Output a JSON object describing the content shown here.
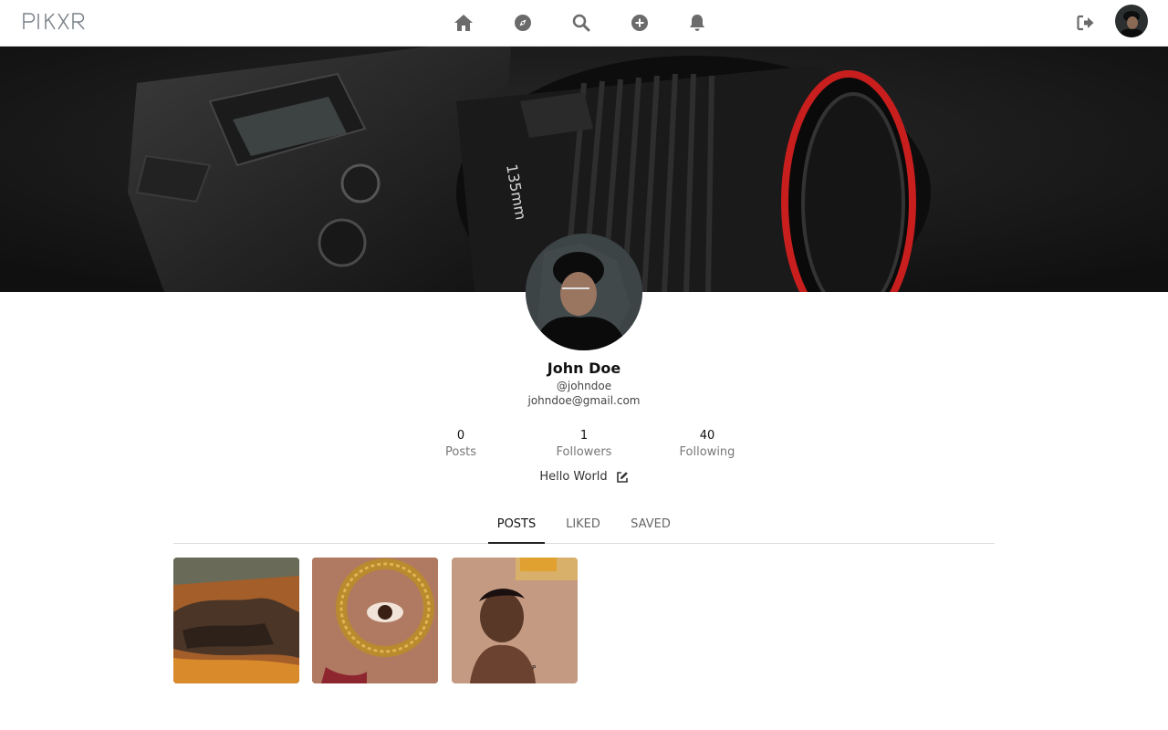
{
  "app": {
    "logo_text": "PIKXR"
  },
  "nav": {
    "icons": [
      "home-icon",
      "explore-icon",
      "search-icon",
      "add-icon",
      "bell-icon"
    ],
    "logout_icon": "logout-icon"
  },
  "profile": {
    "name": "John Doe",
    "handle": "@johndoe",
    "email": "johndoe@gmail.com",
    "bio": "Hello World"
  },
  "stats": {
    "posts": {
      "value": "0",
      "label": "Posts"
    },
    "followers": {
      "value": "1",
      "label": "Followers"
    },
    "following": {
      "value": "40",
      "label": "Following"
    }
  },
  "tabs": {
    "posts": "POSTS",
    "liked": "LIKED",
    "saved": "SAVED",
    "active": "POSTS"
  },
  "posts": [
    {
      "subject": "desert rocks"
    },
    {
      "subject": "eye through gold ring"
    },
    {
      "subject": "child portrait"
    }
  ],
  "colors": {
    "icon": "#6b6b6b",
    "text": "#222222",
    "muted": "#777777"
  }
}
